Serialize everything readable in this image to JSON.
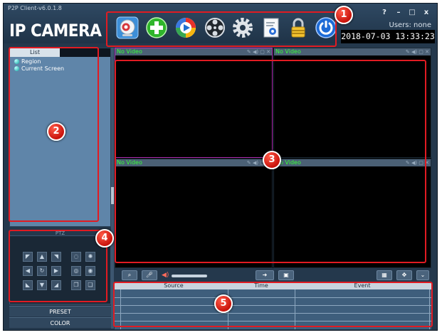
{
  "window": {
    "title": "P2P Client-v6.0.1.8",
    "logo": "IP CAMERA",
    "btn_help": "?",
    "btn_min": "–",
    "btn_max": "□",
    "btn_close": "x"
  },
  "header": {
    "users_label": "Users: none",
    "datetime": "2018-07-03 13:33:23"
  },
  "toolbar": {
    "icons": [
      "camera-icon",
      "add-icon",
      "playback-icon",
      "film-reel-icon",
      "gear-icon",
      "report-icon",
      "lock-icon",
      "power-icon"
    ]
  },
  "sidebar": {
    "tab_label": "List",
    "items": [
      {
        "label": "Region"
      },
      {
        "label": "Current Screen"
      }
    ]
  },
  "ptz": {
    "label": "PTZ"
  },
  "panels": {
    "preset": "PRESET",
    "color": "COLOR"
  },
  "video": {
    "panes": [
      {
        "label": "No Video"
      },
      {
        "label": "No Video"
      },
      {
        "label": "No Video"
      },
      {
        "label": "No Video"
      }
    ]
  },
  "events": {
    "columns": [
      "Source",
      "Time",
      "Event"
    ]
  },
  "annotations": {
    "badge1": "1",
    "badge2": "2",
    "badge3": "3",
    "badge4": "4",
    "badge5": "5"
  },
  "colors": {
    "annotation_red": "#e11b22",
    "video_label_green": "#39ff3a",
    "panel_blue": "#5f85a9"
  }
}
